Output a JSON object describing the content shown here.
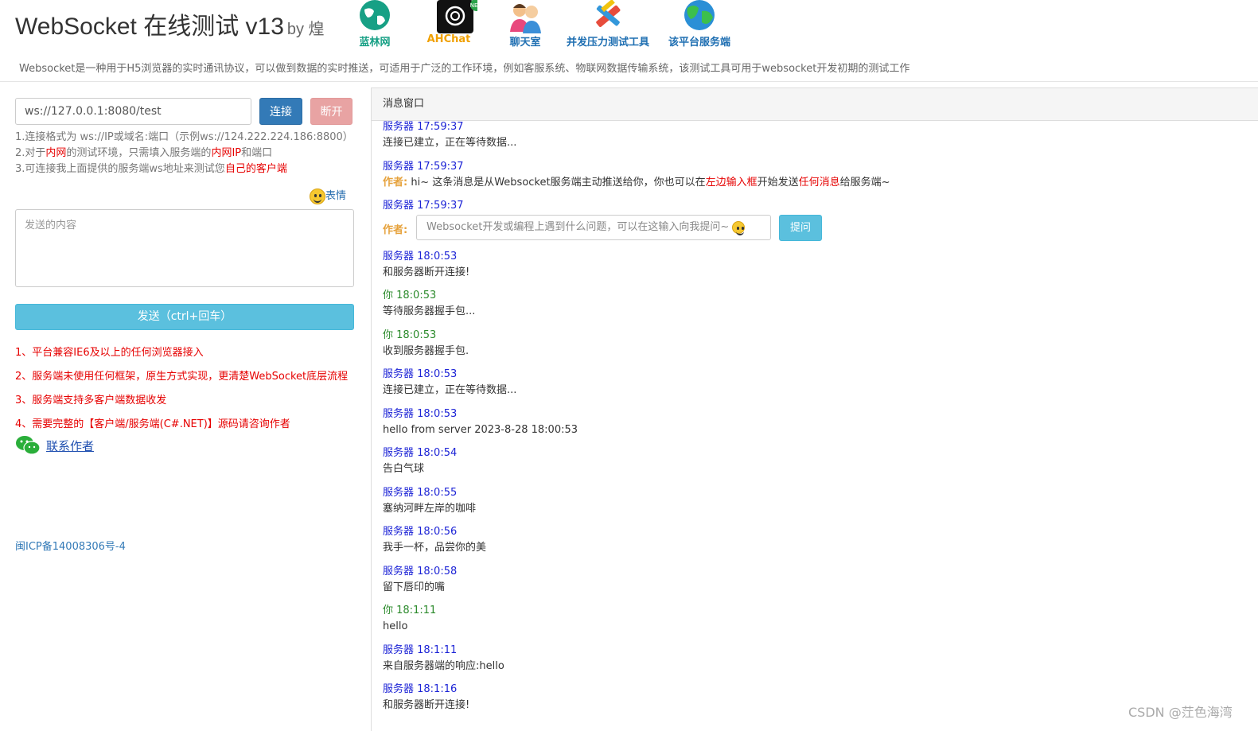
{
  "header": {
    "title": "WebSocket 在线测试 v13",
    "by": "by 煌",
    "nav": [
      {
        "label": "蓝林网",
        "icon": "globe-icon",
        "color": "#17a085"
      },
      {
        "label": "AHChat",
        "icon": "chatgpt-icon",
        "badge": "NEW",
        "color": "#f0a000"
      },
      {
        "label": "聊天室",
        "icon": "people-icon",
        "color": "#e8487d"
      },
      {
        "label": "并发压力测试工具",
        "icon": "tools-icon",
        "color": "#e74c3c"
      },
      {
        "label": "该平台服务端",
        "icon": "earth-icon",
        "color": "#2a8fd6"
      }
    ],
    "description": "Websocket是一种用于H5浏览器的实时通讯协议，可以做到数据的实时推送，可适用于广泛的工作环境，例如客服系统、物联网数据传输系统，该测试工具可用于websocket开发初期的测试工作"
  },
  "left": {
    "url_value": "ws://127.0.0.1:8080/test",
    "connect_label": "连接",
    "disconnect_label": "断开",
    "tip1": "1.连接格式为 ws://IP或域名:端口（示例ws://124.222.224.186:8800）",
    "tip2_a": "2.对于",
    "tip2_b": "内网",
    "tip2_c": "的测试环境，只需填入服务端的",
    "tip2_d": "内网IP",
    "tip2_e": "和端口",
    "tip3_a": "3.可连接我上面提供的服务端ws地址来测试您",
    "tip3_b": "自己的客户端",
    "emoji_label": "表情",
    "send_placeholder": "发送的内容",
    "send_label": "发送（ctrl+回车）",
    "features": [
      "1、平台兼容IE6及以上的任何浏览器接入",
      "2、服务端未使用任何框架，原生方式实现，更清楚WebSocket底层流程",
      "3、服务端支持多客户端数据收发",
      "4、需要完整的【客户端/服务端(C#.NET)】源码请咨询作者"
    ],
    "contact_label": "联系作者",
    "icp": "闽ICP备14008306号-4"
  },
  "right": {
    "heading": "消息窗口",
    "author_label": "作者:",
    "hi_a": "hi~ 这条消息是从Websocket服务端主动推送给你，你也可以在",
    "hi_b": "左边输入框",
    "hi_c": "开始发送",
    "hi_d": "任何消息",
    "hi_e": "给服务端~",
    "ask_placeholder": "Websocket开发或编程上遇到什么问题，可以在这输入向我提问~",
    "ask_label": "提问",
    "messages": [
      {
        "meta": "服务器 17:59:37",
        "body": "连接已建立，正在等待数据..."
      },
      {
        "meta": "服务器 17:59:37"
      },
      {
        "meta": "服务器 17:59:37"
      },
      {
        "meta": "服务器 18:0:53",
        "body": "和服务器断开连接!"
      },
      {
        "meta": "你 18:0:53",
        "body": "等待服务器握手包..."
      },
      {
        "meta": "你 18:0:53",
        "body": "收到服务器握手包."
      },
      {
        "meta": "服务器 18:0:53",
        "body": "连接已建立，正在等待数据..."
      },
      {
        "meta": "服务器 18:0:53",
        "body": "hello from server 2023-8-28 18:00:53"
      },
      {
        "meta": "服务器 18:0:54",
        "body": "告白气球"
      },
      {
        "meta": "服务器 18:0:55",
        "body": "塞纳河畔左岸的咖啡"
      },
      {
        "meta": "服务器 18:0:56",
        "body": "我手一杯，品尝你的美"
      },
      {
        "meta": "服务器 18:0:58",
        "body": "留下唇印的嘴"
      },
      {
        "meta": "你 18:1:11",
        "body": "hello"
      },
      {
        "meta": "服务器 18:1:11",
        "body": "来自服务器端的响应:hello"
      },
      {
        "meta": "服务器 18:1:16",
        "body": "和服务器断开连接!"
      }
    ]
  },
  "watermark": "CSDN @茳色海湾"
}
